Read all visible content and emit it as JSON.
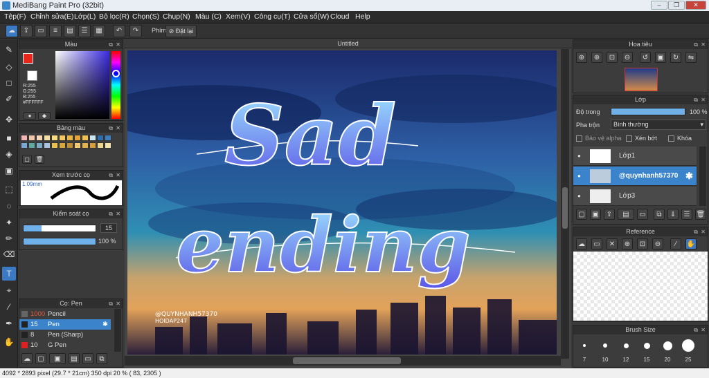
{
  "window": {
    "title": "MediBang Paint Pro (32bit)",
    "min": "‒",
    "max": "❐",
    "close": "✕"
  },
  "menu": [
    "Tệp(F)",
    "Chỉnh sửa(E)",
    "Lớp(L)",
    "Bộ lọc(R)",
    "Chọn(S)",
    "Chụp(N)",
    "Màu (C)",
    "Xem(V)",
    "Công cụ(T)",
    "Cửa sổ(W)",
    "Cloud",
    "Help"
  ],
  "toolbar": {
    "shortcut_label": "Phím",
    "reset_label": "Đặt lại"
  },
  "color_panel": {
    "title": "Màu",
    "r": "R:255",
    "g": "G:255",
    "b": "B:255",
    "hex": "#FFFFFF",
    "primary": "#e8261c",
    "secondary": "#ffffff"
  },
  "palette_panel": {
    "title": "Bảng màu",
    "colors": [
      "#f3b6b3",
      "#f0c5a8",
      "#f6d6b4",
      "#f2e0a6",
      "#f7dd7c",
      "#f5c95d",
      "#e9b740",
      "#e3a53a",
      "#f0c24d",
      "#cde8f4",
      "#2c6eb0",
      "#3f7fbf",
      "#78a9d6",
      "#5ea8a0",
      "#7aa9c5",
      "#a9c3dd",
      "#e8c24b",
      "#d6a53d",
      "#c08c35",
      "#efc777",
      "#e2b34f",
      "#d59c3d",
      "#ebd48b",
      "#f2e2ad"
    ]
  },
  "brush_preview": {
    "title": "Xem trước cọ",
    "size": "1.09mm"
  },
  "brush_control": {
    "title": "Kiểm soát cọ",
    "size_value": "15",
    "opacity_value": "100 %",
    "size_level": 0.25,
    "opacity_level": 1.0
  },
  "brush_list": {
    "title": "Cọ: Pen",
    "items": [
      {
        "size": "1000",
        "name": "Pencil",
        "color": "#666"
      },
      {
        "size": "15",
        "name": "Pen",
        "color": "#222"
      },
      {
        "size": "8",
        "name": "Pen (Sharp)",
        "color": "#222"
      },
      {
        "size": "10",
        "name": "G Pen",
        "color": "#e02020"
      }
    ]
  },
  "canvas": {
    "tab": "Untitled",
    "text_line1": "Sad",
    "text_line2": "ending",
    "watermark_line1": "@QUYNHANH57370",
    "watermark_line2": "HOIDAP247"
  },
  "navigator": {
    "title": "Hoa tiêu"
  },
  "layer_panel": {
    "title": "Lớp",
    "opacity_label": "Độ trong",
    "opacity_value": "100 %",
    "blend_label": "Pha trộn",
    "blend_value": "Bình thường",
    "protect_alpha": "Bảo vệ alpha",
    "clipping": "Xén bớt",
    "lock": "Khóa",
    "layers": [
      {
        "name": "Lớp1",
        "selected": false
      },
      {
        "name": "@quynhanh57370",
        "selected": true
      },
      {
        "name": "Lớp3",
        "selected": false
      }
    ]
  },
  "reference_panel": {
    "title": "Reference"
  },
  "brush_size_panel": {
    "title": "Brush Size",
    "sizes": [
      "7",
      "10",
      "12",
      "15",
      "20",
      "25"
    ]
  },
  "status": "4092 * 2893 pixel   (29.7 * 21cm)   350 dpi   20 %   ( 83, 2305 )"
}
